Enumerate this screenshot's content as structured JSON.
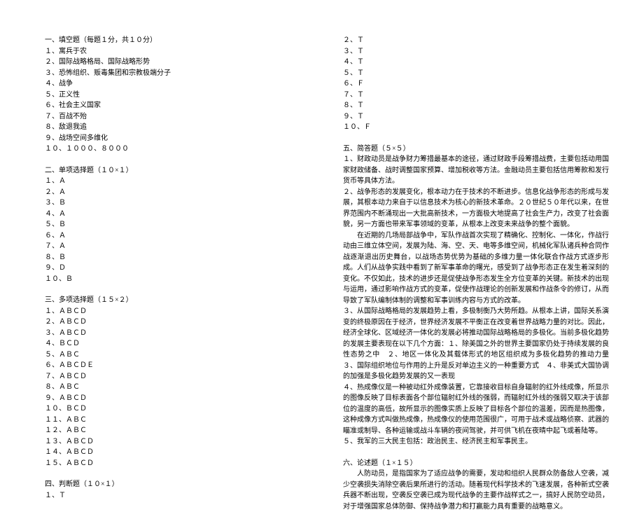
{
  "left": {
    "sec1_h": "一、填空题（每题１分，共１０分）",
    "sec1": [
      "１、寓兵于农",
      "２、国际战略格局、国际战略形势",
      "３、恐怖组织、贩毒集团和宗教极端分子",
      "４、战争",
      "５、正义性",
      "６、社会主义国家",
      "７、百战不殆",
      "８、敌退我追",
      "９、战场空间多维化",
      "１０、１０００、８０００"
    ],
    "sec2_h": "二、单项选择题（１０×１）",
    "sec2": [
      "１、Ａ",
      "２、Ａ",
      "３、Ｂ",
      "４、Ａ",
      "５、Ｂ",
      "６、Ａ",
      "７、Ａ",
      "８、Ｂ",
      "９、Ｄ",
      "１０、Ｂ"
    ],
    "sec3_h": "三、多项选择题（１５×２）",
    "sec3": [
      "１、ＡＢＣＤ",
      "２、ＡＢＣＤ",
      "３、ＡＢＣＤ",
      "４、ＢＣＤ",
      "５、ＡＢＣ",
      "６、ＡＢＣＤＥ",
      "７、ＡＢＣＤ",
      "８、ＡＢＣ",
      "９、ＡＢＣＤ",
      "１０、ＢＣＤ",
      "１１、ＡＢＣ",
      "１２、ＡＢＣ",
      "１３、ＡＢＣＤ",
      "１４、ＡＢＣＤ",
      "１５、ＡＢＣＤ"
    ],
    "sec4_h": "四、判断题（１０×１）",
    "sec4": [
      "１、Ｔ"
    ]
  },
  "right": {
    "sec4_cont": [
      "２、Ｔ",
      "３、Ｔ",
      "４、Ｔ",
      "５、Ｔ",
      "６、Ｆ",
      "７、Ｔ",
      "８、Ｔ",
      "９、Ｔ",
      "１０、Ｆ"
    ],
    "sec5_h": "五、简答题（５×５）",
    "a1": "１、财政动员是战争财力筹措最基本的途径，通过财政手段筹措战费，主要包括动用国家财政储备、战时调整国家预算、增加税收等方法。金融动员主要包括信用筹款和发行货币等具体方法。",
    "a2": "２、战争形态的发展变化，根本动力在于技术的不断进步。信息化战争形态的形成与发展，其根本动力来自于以信息技术为核心的新技术革命。２０世纪５０年代以来，在世界范围内不断涌现出一大批高新技术，一方面极大地提高了社会生产力，改变了社会面貌，另一方面也带来军事领域的变革，从根本上改变未来战争的整个面貌。",
    "a2b": "在近期的几场局部战争中，军队作战首次实现了精确化、控制化、一体化，作战行动由三维立体空间，发展为陆、海、空、天、电等多维空间，机械化军队诸兵种合同作战逐渐退出历史舞台，以战场态势优势为基础的多维力量一体化联合作战方式逐步形成。人们从战争实践中看到了新军事革命的曙光，感受到了战争形态正在发生着深刻的变化。不仅如此，技术的进步还是促使战争形态发生全方位变革的关键。新技术的出现与运用，通过影响作战方式的变革，促使作战理论的创新发展和作战条令的修订，从而导致了军队编制体制的调整和军事训练内容与方式的改革。",
    "a3": "３、从国际战略格局的发展趋势上看，多极制衡乃大势所趋。从根本上讲，国际关系演变的终极原因在于经济，世界经济发展不平衡正在改变着世界战略力量的对比。因此，经济全球化、区域经济一体化的发展必将推动国际战略格局的多极化。当前多极化趋势的发展主要表现在以下几个方面：１、除美国之外的世界主要国家仍处于持续发展的良性态势之中　２、地区一体化及其载体形式的地区组织成为多极化趋势的推动力量　３、国际组织地位与作用的上升是反对单边主义的一种重要方式　４、非美式大国协调的加强是多极化趋势发展的又一表现",
    "a4": "４、热成像仪是一种被动红外成像装置，它靠接收目标自身辐射的红外线成像，所显示的图像反映了目标表面各个部位辐射红外线的强弱，而辐射红外线的强弱又取决于该部位的温度的高低，故所显示的图像实质上反映了目标各个部位的温差，因而是热图像，这种成像方式叫做热成像，热成像仪的使用范围很广，可用于战术或战略侦察、武器的瞄准或制导、各种运输或战斗车辆的夜间驾驶，并可供飞机在夜晴中起飞或着陆等。",
    "a5": "５、我军的三大民主包括：政治民主、经济民主和军事民主。",
    "sec6_h": "六、论述题（１×１５）",
    "a6": "人防动员，是指国家为了适应战争的需要，发动和组织人民群众防备敌人空袭，减少空袭损失消除空袭后果所进行的活动。随着现代科学技术的飞速发展，各种新式空袭兵器不断出现，空袭反空袭已成为现代战争的主要作战样式之一，搞好人民防空动员，对于增强国家总体防御、保持战争潜力和打赢能力具有重要的战略意义。"
  }
}
